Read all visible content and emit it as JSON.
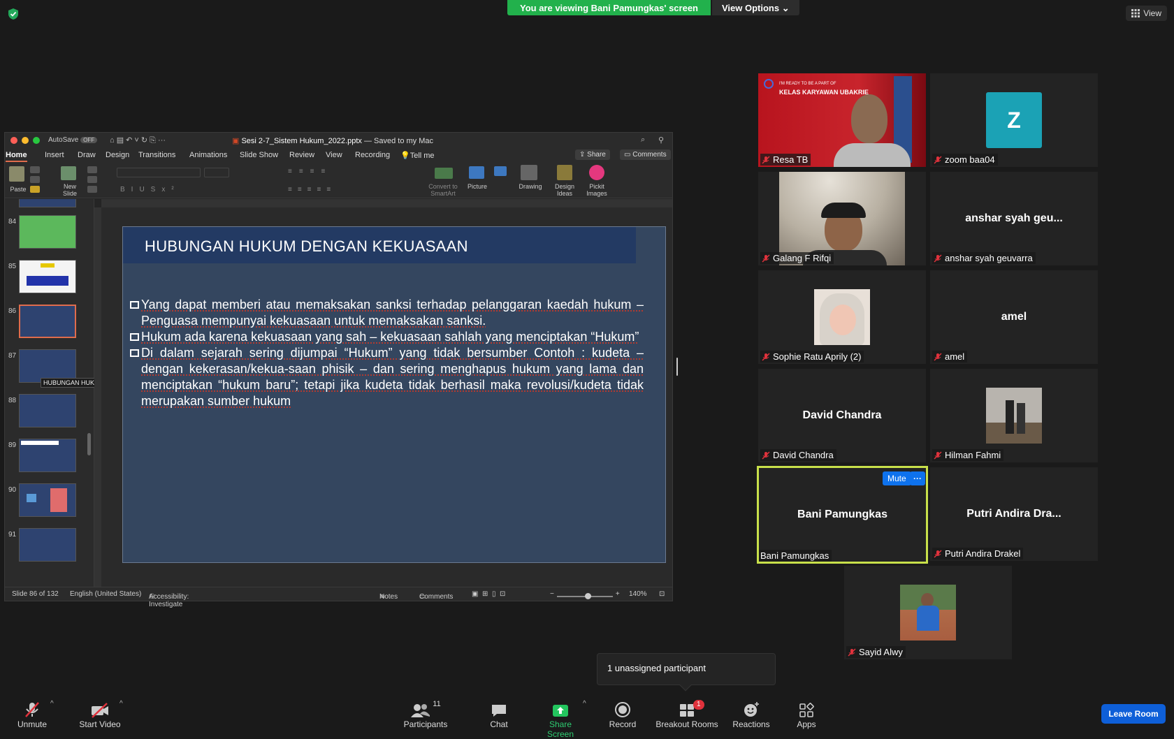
{
  "banner": {
    "message": "You are viewing Bani Pamungkas' screen",
    "view_options": "View Options"
  },
  "top_right": {
    "view_label": "View"
  },
  "ppt": {
    "autosave": "AutoSave",
    "autosave_state": "OFF",
    "file_name": "Sesi 2-7_Sistem Hukum_2022.pptx",
    "saved_state": "— Saved to my Mac",
    "tabs": [
      "Home",
      "Insert",
      "Draw",
      "Design",
      "Transitions",
      "Animations",
      "Slide Show",
      "Review",
      "View",
      "Recording",
      "Tell me"
    ],
    "share": "Share",
    "comments": "Comments",
    "ribbon_labels": {
      "paste": "Paste",
      "new_slide": "New\nSlide",
      "convert": "Convert to\nSmartArt",
      "picture": "Picture",
      "drawing": "Drawing",
      "design_ideas": "Design\nIdeas",
      "pickit": "Pickit\nImages"
    },
    "thumbnail_numbers": [
      "84",
      "85",
      "86",
      "87",
      "88",
      "89",
      "90",
      "91"
    ],
    "tooltip": "HUBUNGAN HUKUM DENGAN KEKUASAAN",
    "status": {
      "slide": "Slide 86 of 132",
      "language": "English (United States)",
      "accessibility": "Accessibility: Investigate",
      "notes": "Notes",
      "comments": "Comments",
      "zoom": "140%"
    }
  },
  "slide": {
    "title": "HUBUNGAN HUKUM DENGAN KEKUASAAN",
    "bullets": [
      "Yang dapat memberi atau memaksakan sanksi terhadap pelanggaran kaedah hukum – Penguasa mempunyai kekuasaan untuk memaksakan sanksi.",
      "Hukum ada karena kekuasaan yang sah – kekuasaan sahlah yang menciptakan “Hukum”",
      "Di dalam sejarah sering dijumpai “Hukum” yang tidak bersumber Contoh : kudeta – dengan kekerasan/kekua-saan phisik – dan sering menghapus hukum yang lama dan menciptakan “hukum baru”; tetapi jika kudeta tidak berhasil maka revolusi/kudeta tidak merupakan sumber hukum"
    ]
  },
  "participants": [
    {
      "name": "Resa TB",
      "video": true
    },
    {
      "name": "zoom baa04",
      "avatar_letter": "Z"
    },
    {
      "name": "Galang F Rifqi",
      "video": true
    },
    {
      "name": "anshar syah geuvarra",
      "display": "anshar syah geu..."
    },
    {
      "name": "Sophie Ratu Aprily (2)",
      "photo": true
    },
    {
      "name": "amel",
      "display": "amel"
    },
    {
      "name": "David Chandra",
      "display": "David Chandra"
    },
    {
      "name": "Hilman Fahmi",
      "photo": true
    },
    {
      "name": "Bani Pamungkas",
      "display": "Bani Pamungkas",
      "mute_label": "Mute",
      "more_label": "···"
    },
    {
      "name": "Putri Andira Drakel",
      "display": "Putri Andira Dra..."
    },
    {
      "name": "Sayid Alwy",
      "photo": true
    }
  ],
  "tile_banner": {
    "line1": "I'M READY TO BE A PART OF",
    "line2": "KELAS KARYAWAN UBAKRIE"
  },
  "unassigned": "1 unassigned participant",
  "toolbar": {
    "unmute": "Unmute",
    "start_video": "Start Video",
    "participants": "Participants",
    "participant_count": "11",
    "chat": "Chat",
    "share_screen": "Share Screen",
    "record": "Record",
    "breakout_rooms": "Breakout Rooms",
    "breakout_badge": "1",
    "reactions": "Reactions",
    "apps": "Apps",
    "leave_room": "Leave Room"
  },
  "colors": {
    "share_green": "#22b14c",
    "active_speaker": "#c8e04a",
    "leave_blue": "#0e5fd8",
    "slide_bg": "#34465f"
  }
}
